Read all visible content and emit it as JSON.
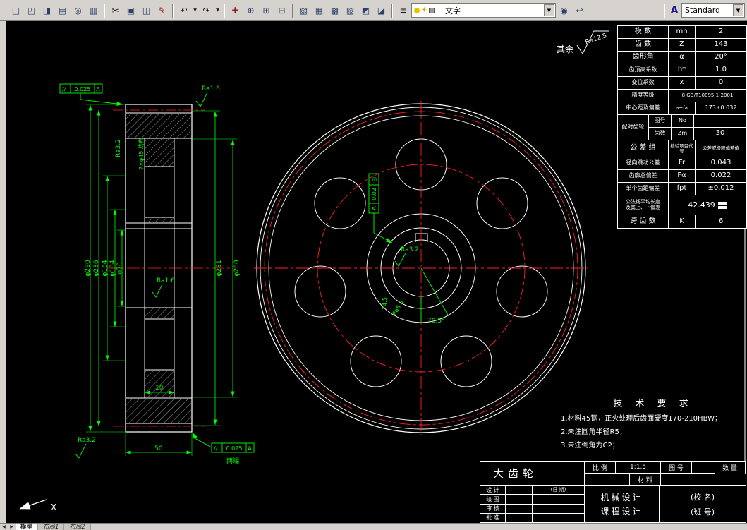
{
  "toolbar": {
    "layer_value": "文字",
    "style_value": "Standard",
    "style_icon": "A",
    "icons": {
      "new": "□",
      "open": "◰",
      "save": "◨",
      "plot": "▤",
      "preview": "◎",
      "publish": "▥",
      "cut": "✂",
      "copy": "▣",
      "paste": "◫",
      "matchprop": "✎",
      "undo": "↶",
      "redo": "↷",
      "pan": "✚",
      "zoom": "⊕",
      "zoomwin": "⊞",
      "zoomprev": "⊟",
      "properties": "▧",
      "designcenter": "▦",
      "palettes": "▩",
      "sheetset": "▨",
      "markup": "◩",
      "calc": "◪",
      "layerprops": "≡",
      "makecurrent": "◉",
      "layerprev": "↩",
      "sun": "☀",
      "down": "▼"
    }
  },
  "tabs": {
    "nav_left": "◀",
    "nav_right": "▶",
    "items": [
      "模型",
      "布局1",
      "布局2"
    ]
  },
  "ucs": {
    "x_label": "X"
  },
  "drawing": {
    "surface_prefix": "其余",
    "surface_value": "Ra12.5",
    "f1_sym": "//",
    "f1_val": "0.025",
    "f1_datum": "A",
    "f2_sym": "//",
    "f2_val": "0.025",
    "f2_datum": "A",
    "f2_note": "两端",
    "f3_sym": "◎",
    "f3_val": "0.02",
    "f3_datum": "A",
    "ra16_top": "Ra1.6",
    "ra16_mid": "Ra1.6",
    "ra32_left": "Ra3.2",
    "ra32_bottom": "Ra3.2",
    "ra32_hub": "Ra3.2",
    "ra63": "Ra6.3",
    "holes_note": "7×φ45 均布",
    "d290": "φ290",
    "d286": "φ286",
    "d164": "φ164",
    "d104": "φ104",
    "d70": "φ70",
    "d281": "φ281",
    "d230": "φ230",
    "w50": "50",
    "s10": "10",
    "kw_dim": "74.5",
    "angle": "70.5°"
  },
  "gear_table": {
    "rows": [
      {
        "l": "模  数",
        "s": "mn",
        "v": "2"
      },
      {
        "l": "齿  数",
        "s": "Z",
        "v": "143"
      },
      {
        "l": "齿形角",
        "s": "α",
        "v": "20°"
      },
      {
        "l": "齿顶高系数",
        "s": "h*",
        "v": "1.0"
      },
      {
        "l": "变位系数",
        "s": "x",
        "v": "0"
      },
      {
        "l": "精度等级",
        "v": "8  GB/T10095.1-2001"
      },
      {
        "l": "中心距及偏差",
        "s": "a±fa",
        "v": "173±0.032"
      }
    ],
    "mate": {
      "l": "配对齿轮",
      "r1k": "图号",
      "r1s": "No",
      "r1v": "",
      "r2k": "齿数",
      "r2s": "Zm",
      "r2v": "30"
    },
    "group": {
      "l": "公 差 组",
      "mid": "检验项目代号",
      "right": "公差或极限偏差值"
    },
    "rows2": [
      {
        "l": "径向跳动公差",
        "s": "Fr",
        "v": "0.043"
      },
      {
        "l": "齿廓总偏差",
        "s": "Fα",
        "v": "0.022"
      },
      {
        "l": "单个齿距偏差",
        "s": "fpt",
        "v": "±0.012"
      }
    ],
    "wk": {
      "l1": "公法线平均长度",
      "l2": "及其上、下偏差",
      "v": "42.439"
    },
    "span": {
      "l": "跨 齿 数",
      "s": "K",
      "v": "6"
    }
  },
  "tech_req": {
    "title": "技 术 要 求",
    "items": [
      "1.材料45钢，正火处理后齿面硬度170-210HBW；",
      "2.未注圆角半径R5；",
      "3.未注倒角为C2；"
    ]
  },
  "title_block": {
    "part_name": "大齿轮",
    "scale_label": "比 例",
    "scale_value": "1:1.5",
    "drawno_label": "图 号",
    "qty_label": "数 量",
    "material_label": "材 料",
    "row_labels": [
      "设 计",
      "绘 图",
      "审 核",
      "批 准"
    ],
    "date_label": "(日 期)",
    "org_line1": "机械设计",
    "org_line2": "课程设计",
    "school": "(校  名)",
    "class": "(班  号)"
  }
}
